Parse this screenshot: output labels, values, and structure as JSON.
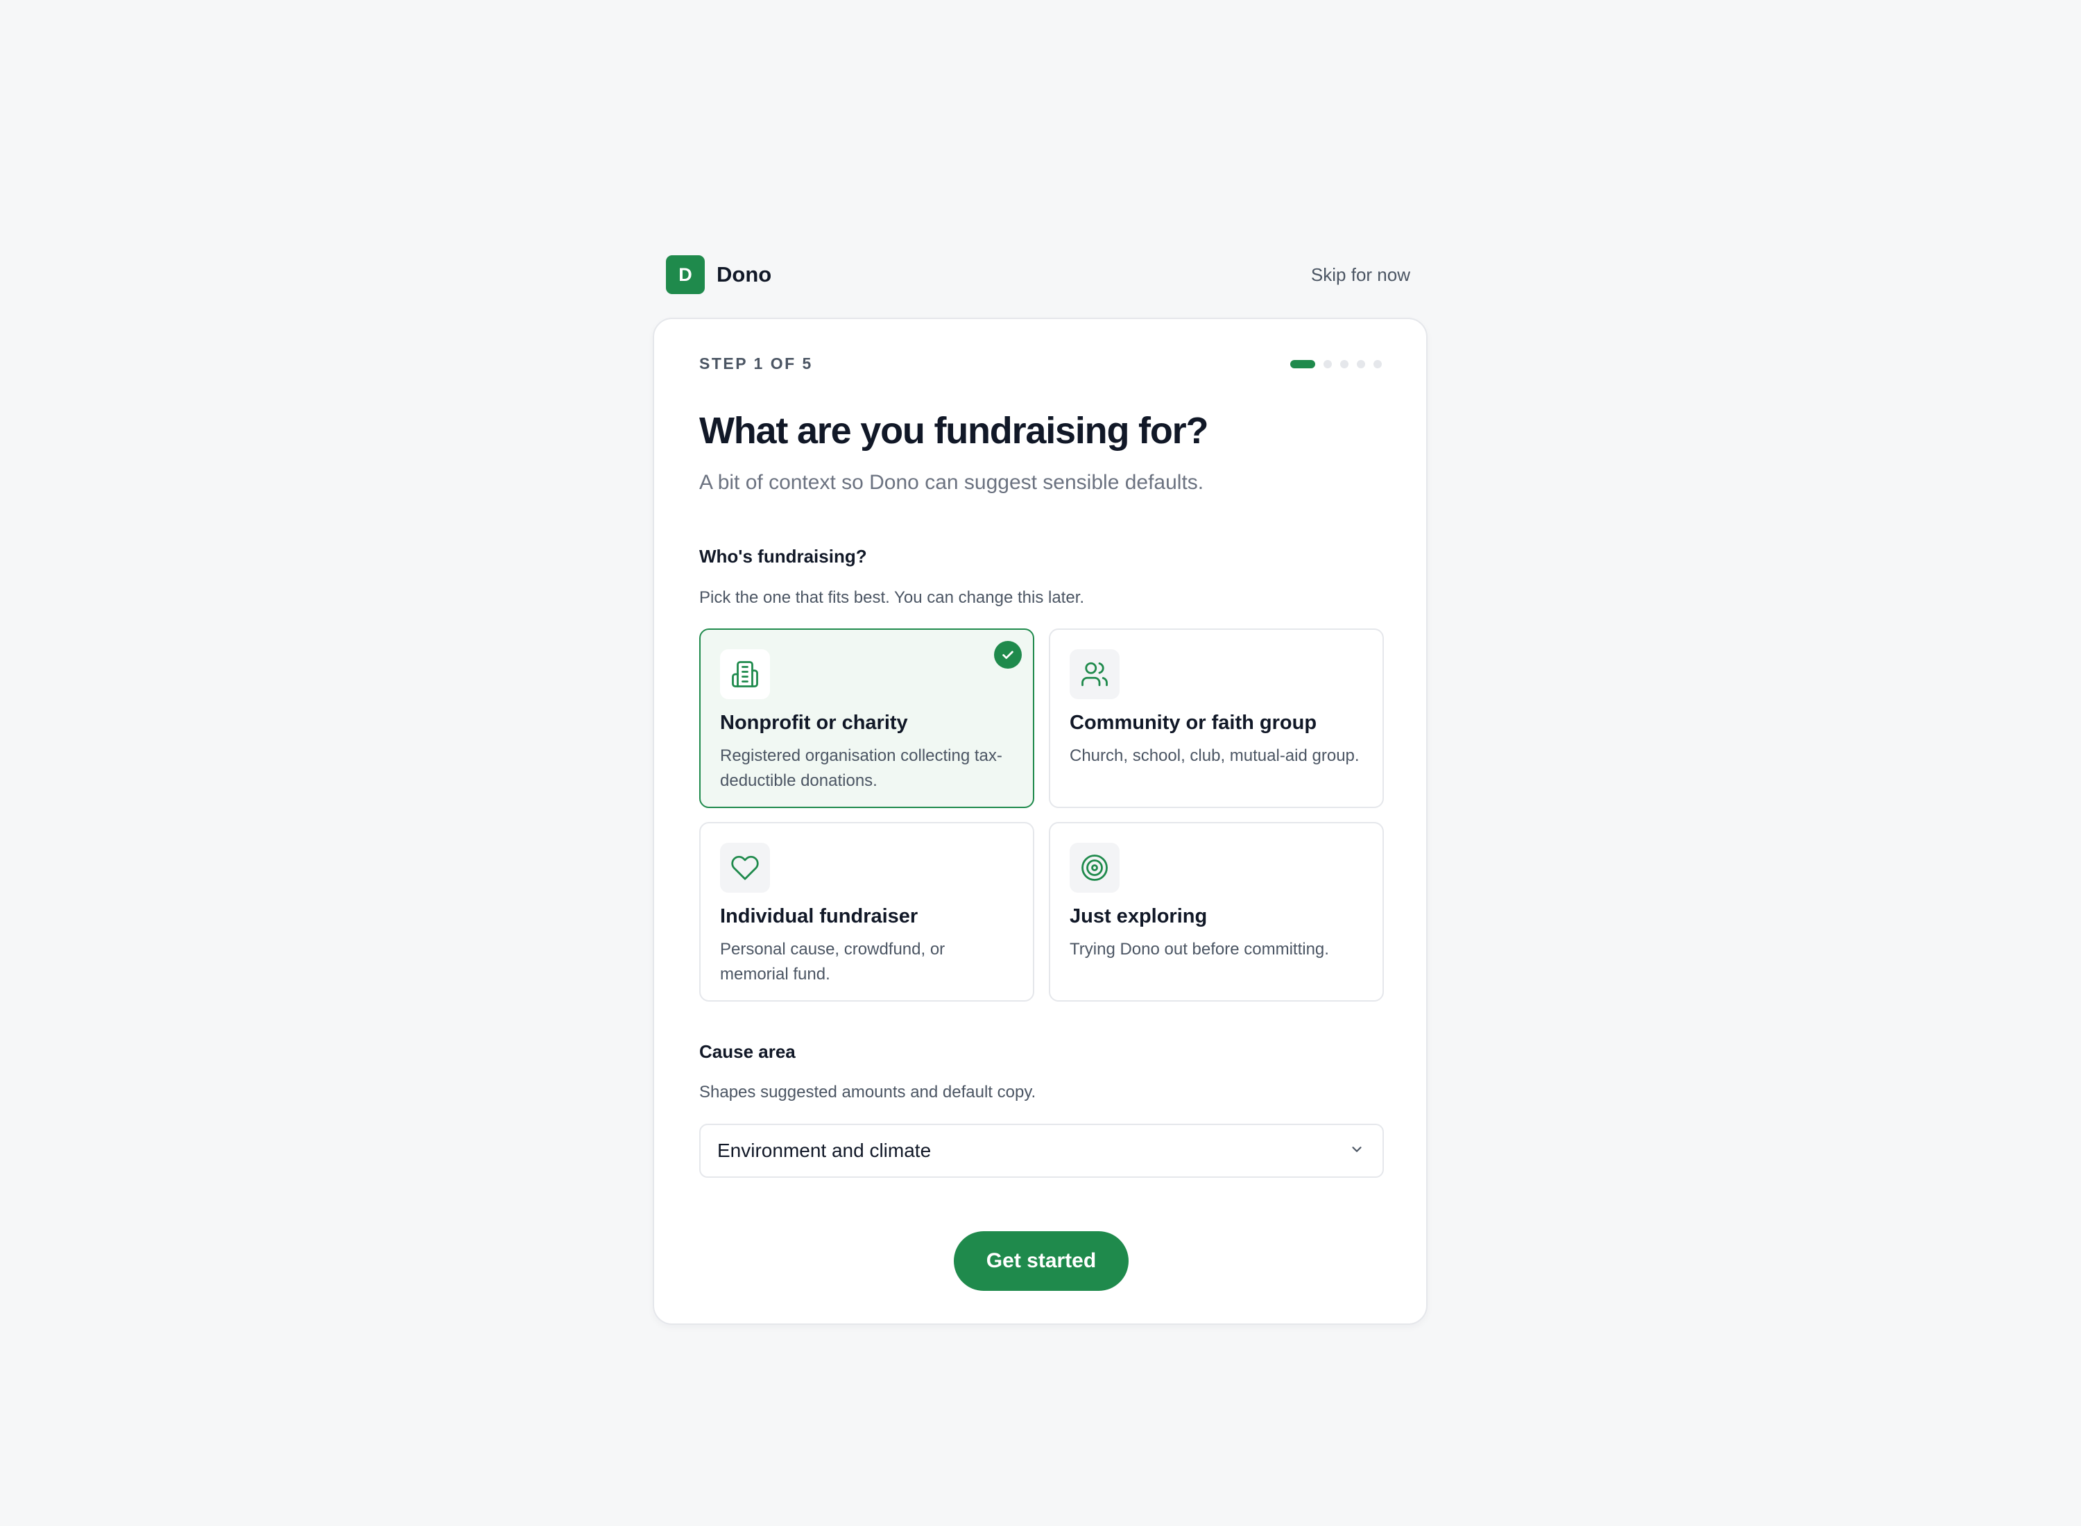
{
  "brand": {
    "logo_letter": "D",
    "name": "Dono",
    "accent": "#1f8a4c"
  },
  "header": {
    "skip_label": "Skip for now"
  },
  "step": {
    "label": "STEP 1 OF 5",
    "current": 1,
    "total": 5
  },
  "title": "What are you fundraising for?",
  "subtitle": "A bit of context so Dono can suggest sensible defaults.",
  "who": {
    "label": "Who's fundraising?",
    "hint": "Pick the one that fits best. You can change this later.",
    "options": [
      {
        "icon": "building-icon",
        "title": "Nonprofit or charity",
        "description": "Registered organisation collecting tax-deductible donations.",
        "selected": true
      },
      {
        "icon": "users-icon",
        "title": "Community or faith group",
        "description": "Church, school, club, mutual-aid group.",
        "selected": false
      },
      {
        "icon": "heart-icon",
        "title": "Individual fundraiser",
        "description": "Personal cause, crowdfund, or memorial fund.",
        "selected": false
      },
      {
        "icon": "target-icon",
        "title": "Just exploring",
        "description": "Trying Dono out before committing.",
        "selected": false
      }
    ]
  },
  "cause": {
    "label": "Cause area",
    "hint": "Shapes suggested amounts and default copy.",
    "selected_value": "Environment and climate"
  },
  "cta_label": "Get started"
}
